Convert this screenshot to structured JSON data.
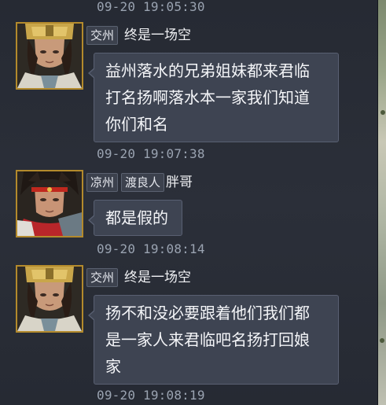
{
  "messages": [
    {
      "timestamp": "09-20 19:05:30"
    },
    {
      "tags": [
        "交州"
      ],
      "name": "终是一场空",
      "avatar_icon": "warrior-gold-crown-portrait",
      "lines": [
        "益州落水的兄弟姐妹都来君临",
        "打名扬啊落水本一家我们知道",
        "你们和名"
      ],
      "timestamp": "09-20 19:07:38"
    },
    {
      "tags": [
        "凉州",
        "渡良人"
      ],
      "name": "胖哥",
      "avatar_icon": "warrior-red-headband-portrait",
      "lines": [
        "都是假的"
      ],
      "timestamp": "09-20 19:08:14"
    },
    {
      "tags": [
        "交州"
      ],
      "name": "终是一场空",
      "avatar_icon": "warrior-gold-crown-portrait",
      "lines": [
        "扬不和没必要跟着他们我们都",
        "是一家人来君临吧名扬打回娘",
        "家"
      ],
      "timestamp": "09-20 19:08:19"
    }
  ],
  "colors": {
    "panel_bg": "#2a2e38",
    "bubble_bg": "#3e4452",
    "timestamp_text": "#9aa3b1",
    "avatar_border": "#b38a2c"
  }
}
